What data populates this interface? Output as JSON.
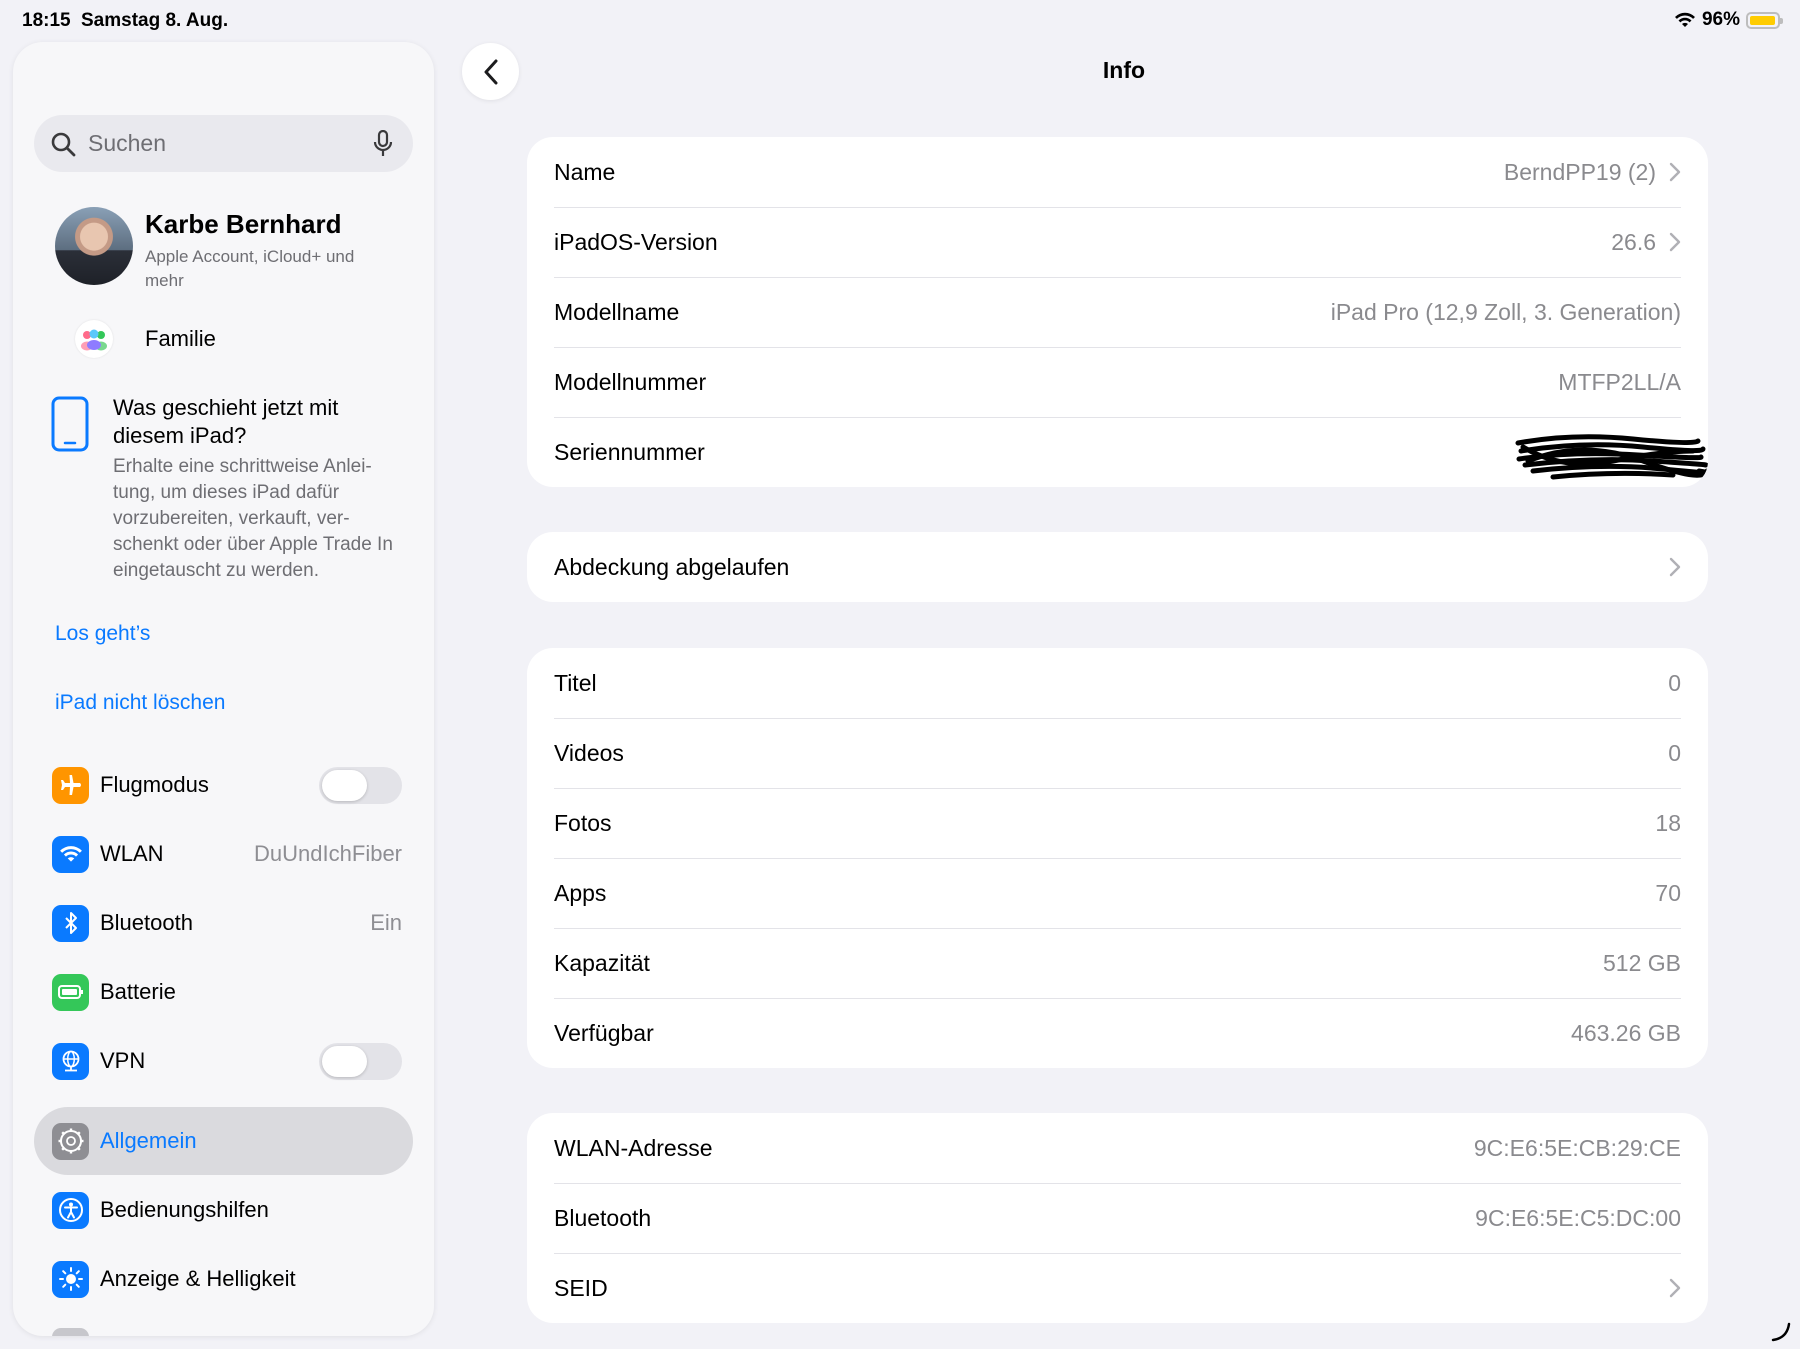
{
  "status_bar": {
    "time": "18:15",
    "date": "Samstag 8. Aug.",
    "battery_percent": "96%",
    "battery_level": 0.96,
    "battery_color": "#ffcc00"
  },
  "sidebar": {
    "search": {
      "placeholder": "Suchen"
    },
    "profile": {
      "name": "Karbe Bernhard",
      "subtitle": "Apple Account, iCloud+ und mehr"
    },
    "family": {
      "label": "Familie"
    },
    "promo": {
      "title": "Was geschieht jetzt mit diesem iPad?",
      "text": "Erhalte eine schrittweise Anlei-tung, um dieses iPad dafür vorzubereiten, verkauft, ver-schenkt oder über Apple Trade In eingetauscht zu werden.",
      "link_start": "Los geht’s",
      "link_keep": "iPad nicht löschen"
    },
    "items": [
      {
        "label": "Flugmodus",
        "icon": "airplane-icon",
        "color": "#ff9500",
        "toggle": false
      },
      {
        "label": "WLAN",
        "icon": "wifi-icon",
        "color": "#0a7aff",
        "value": "DuUndIchFiber"
      },
      {
        "label": "Bluetooth",
        "icon": "bluetooth-icon",
        "color": "#0a7aff",
        "value": "Ein"
      },
      {
        "label": "Batterie",
        "icon": "battery-icon",
        "color": "#34c759"
      },
      {
        "label": "VPN",
        "icon": "vpn-globe-icon",
        "color": "#0a7aff",
        "toggle": false
      },
      {
        "label": "Allgemein",
        "icon": "gear-icon",
        "color": "#8e8e93",
        "selected": true
      },
      {
        "label": "Bedienungshilfen",
        "icon": "accessibility-icon",
        "color": "#0a7aff"
      },
      {
        "label": "Anzeige & Helligkeit",
        "icon": "brightness-icon",
        "color": "#0a7aff"
      }
    ]
  },
  "main": {
    "title": "Info",
    "group1": [
      {
        "label": "Name",
        "value": "BerndPP19 (2)",
        "chevron": true
      },
      {
        "label": "iPadOS-Version",
        "value": "26.6",
        "chevron": true
      },
      {
        "label": "Modellname",
        "value": "iPad Pro (12,9 Zoll, 3. Generation)"
      },
      {
        "label": "Modellnummer",
        "value": "MTFP2LL/A"
      },
      {
        "label": "Seriennummer",
        "value": "",
        "redacted": true
      }
    ],
    "group2": [
      {
        "label": "Abdeckung abgelaufen",
        "chevron": true
      }
    ],
    "group3": [
      {
        "label": "Titel",
        "value": "0"
      },
      {
        "label": "Videos",
        "value": "0"
      },
      {
        "label": "Fotos",
        "value": "18"
      },
      {
        "label": "Apps",
        "value": "70"
      },
      {
        "label": "Kapazität",
        "value": "512 GB"
      },
      {
        "label": "Verfügbar",
        "value": "463.26 GB"
      }
    ],
    "group4": [
      {
        "label": "WLAN-Adresse",
        "value": "9C:E6:5E:CB:29:CE"
      },
      {
        "label": "Bluetooth",
        "value": "9C:E6:5E:C5:DC:00"
      },
      {
        "label": "SEID",
        "chevron": true
      }
    ]
  },
  "colors": {
    "accent": "#0a7aff",
    "background": "#f2f2f7",
    "selected_row": "#dadade"
  }
}
